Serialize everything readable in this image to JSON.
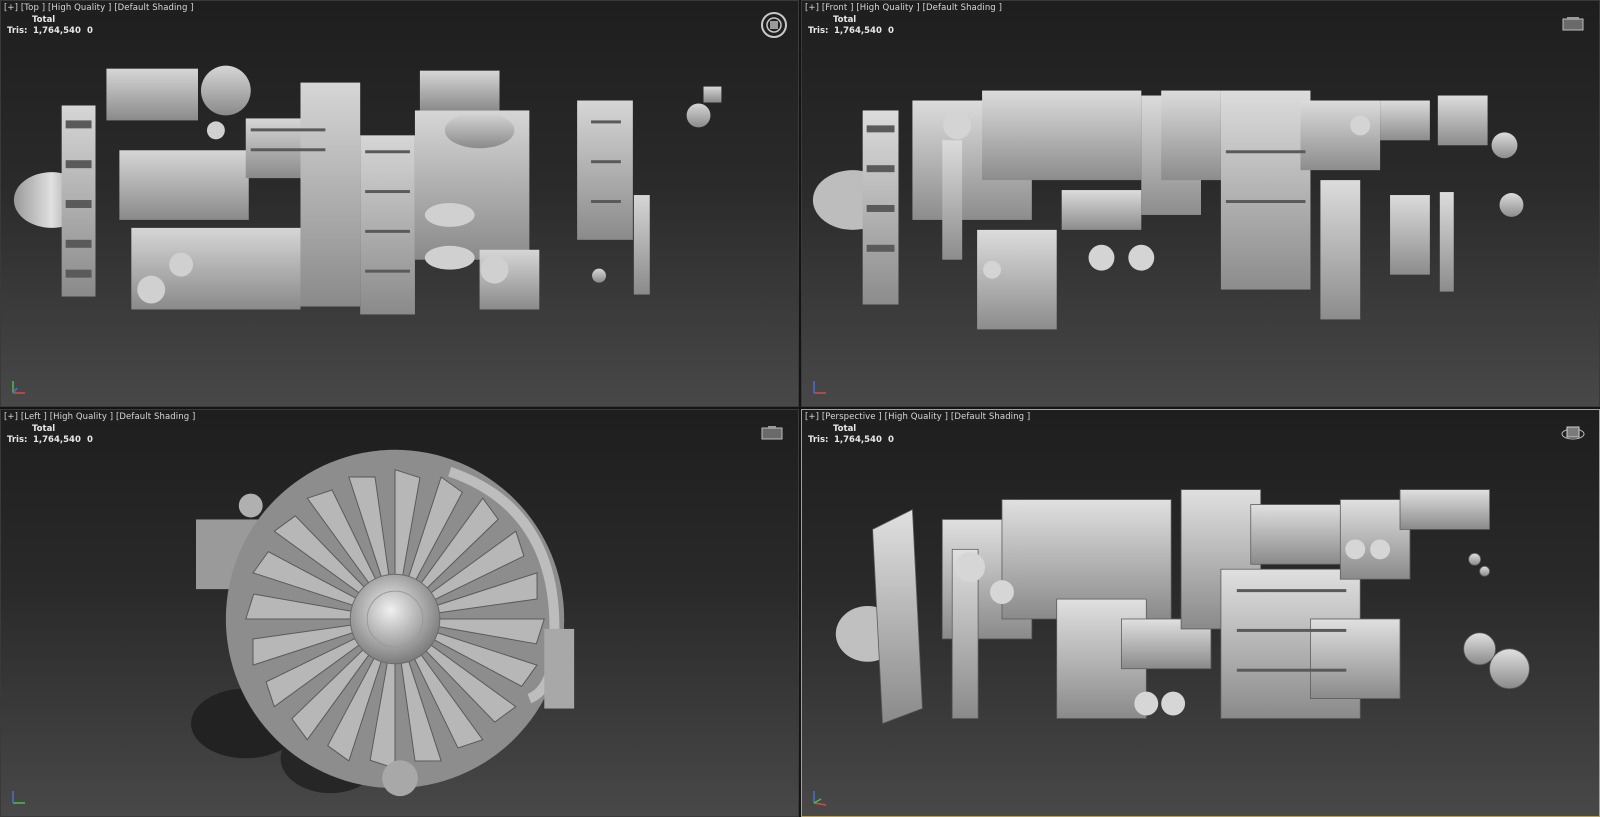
{
  "viewports": [
    {
      "id": "top",
      "plus": "[+]",
      "view": "[Top ]",
      "quality": "[High Quality ]",
      "shading": "[Default Shading ]",
      "stats_header": "Total",
      "stats_label": "Tris:",
      "stats_value": "1,764,540",
      "stats_extra": "0",
      "gizmo": "steering-wheel-icon"
    },
    {
      "id": "front",
      "plus": "[+]",
      "view": "[Front ]",
      "quality": "[High Quality ]",
      "shading": "[Default Shading ]",
      "stats_header": "Total",
      "stats_label": "Tris:",
      "stats_value": "1,764,540",
      "stats_extra": "0",
      "gizmo": "viewcube-icon"
    },
    {
      "id": "left",
      "plus": "[+]",
      "view": "[Left ]",
      "quality": "[High Quality ]",
      "shading": "[Default Shading ]",
      "stats_header": "Total",
      "stats_label": "Tris:",
      "stats_value": "1,764,540",
      "stats_extra": "0",
      "gizmo": "viewcube-icon"
    },
    {
      "id": "perspective",
      "plus": "[+]",
      "view": "[Perspective ]",
      "quality": "[High Quality ]",
      "shading": "[Default Shading ]",
      "stats_header": "Total",
      "stats_label": "Tris:",
      "stats_value": "1,764,540",
      "stats_extra": "0",
      "gizmo": "orbit-viewcube-icon",
      "active": true
    }
  ],
  "colors": {
    "background_top": "#1e1e1e",
    "background_bottom": "#484848",
    "active_border": "#b9a257",
    "model_gray": "#b8b8b8"
  }
}
